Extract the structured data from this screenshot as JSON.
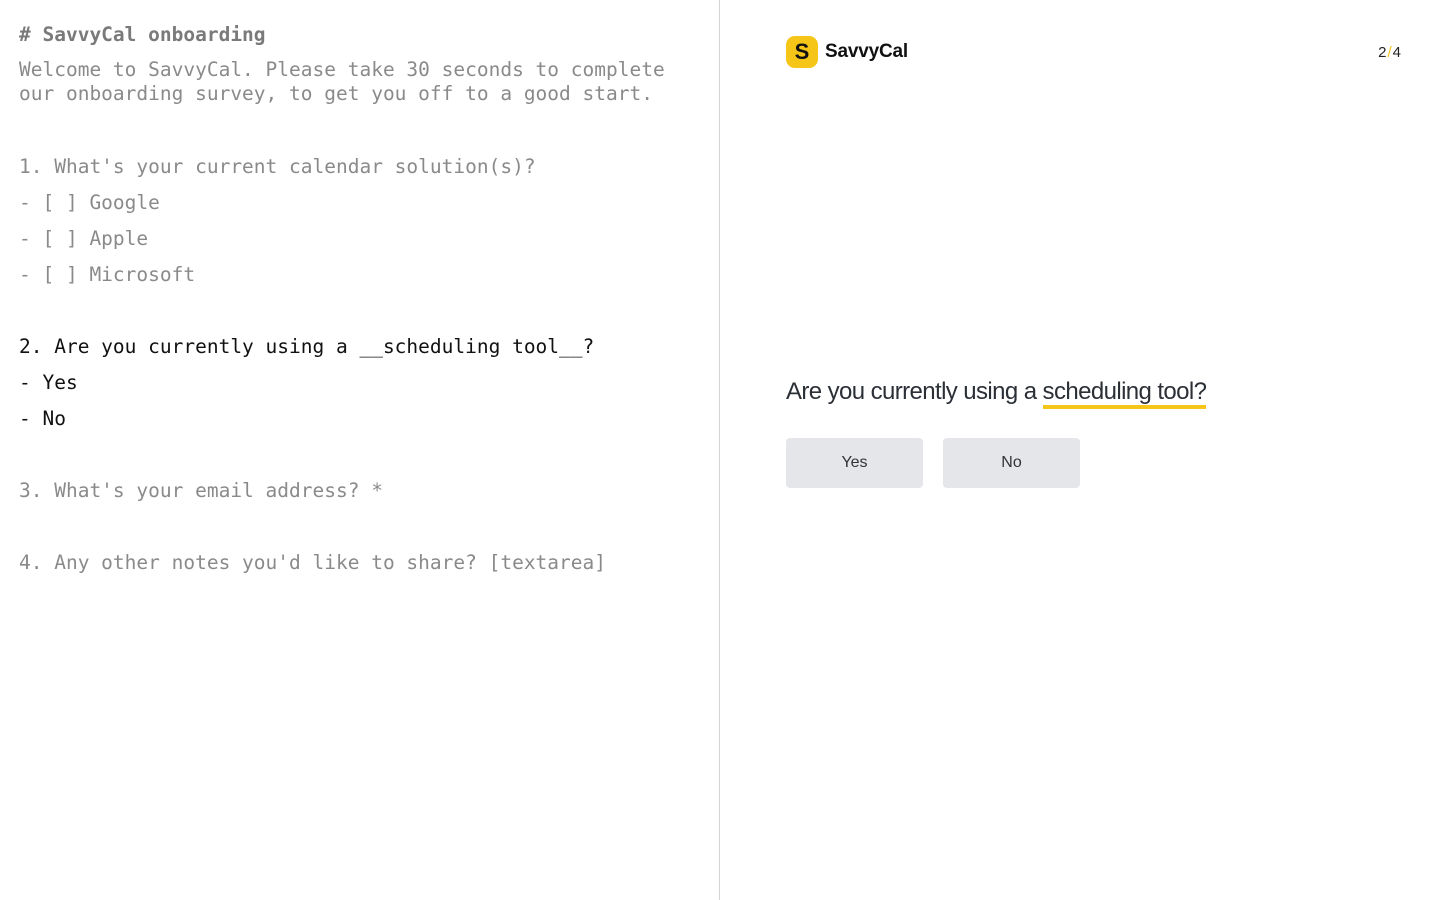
{
  "editor": {
    "title": "# SavvyCal onboarding",
    "intro": "Welcome to SavvyCal. Please take 30 seconds to complete our onboarding survey, to get you off to a good start.",
    "q1": {
      "text": "1. What's your current calendar solution(s)?",
      "options": [
        "- [ ] Google",
        "- [ ] Apple",
        "- [ ] Microsoft"
      ]
    },
    "q2": {
      "text": "2. Are you currently using a __scheduling tool__?",
      "options": [
        "- Yes",
        "- No"
      ]
    },
    "q3": {
      "text": "3. What's your email address? *"
    },
    "q4": {
      "text": "4. Any other notes you'd like to share? [textarea]"
    }
  },
  "preview": {
    "brand": {
      "mark": "S",
      "name": "SavvyCal"
    },
    "step": {
      "current": "2",
      "separator": "/",
      "total": "4"
    },
    "question": {
      "prefix": "Are you currently using a ",
      "highlight": "scheduling tool?"
    },
    "answers": [
      "Yes",
      "No"
    ],
    "accent_color": "#f5c518"
  }
}
